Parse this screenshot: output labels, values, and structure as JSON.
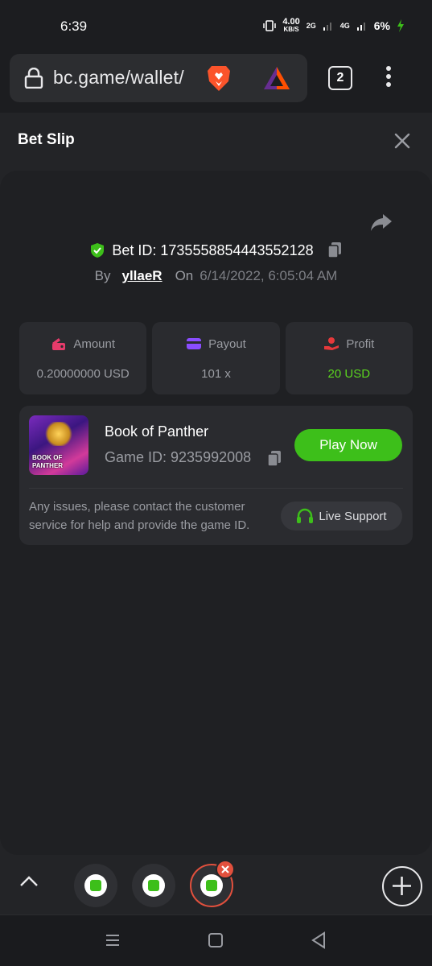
{
  "status": {
    "time": "6:39",
    "speed_value": "4.00",
    "speed_unit": "KB/S",
    "net_2g": "2G",
    "net_4g": "4G",
    "battery": "6%"
  },
  "browser": {
    "url": "bc.game/wallet/",
    "tab_count": "2",
    "icons": [
      "lock-icon",
      "brave-lion-icon",
      "brave-rewards-icon",
      "more-vert-icon"
    ]
  },
  "slip": {
    "title": "Bet Slip",
    "bet_id_label": "Bet ID: 1735558854443552128",
    "by_label": "By",
    "user": "yllaeR",
    "on_label": "On",
    "date": "6/14/2022, 6:05:04 AM"
  },
  "stats": [
    {
      "label": "Amount",
      "value": "0.20000000 USD",
      "icon": "amount-icon",
      "color": "#e63b6b"
    },
    {
      "label": "Payout",
      "value": "101 x",
      "icon": "payout-card-icon",
      "color": "#8a4dff"
    },
    {
      "label": "Profit",
      "value": "20 USD",
      "icon": "profit-hand-icon",
      "color": "#e6393b"
    }
  ],
  "game": {
    "name": "Book of Panther",
    "game_id_label": "Game ID: 9235992008",
    "play_label": "Play Now",
    "thumb_text": "BOOK OF PANTHER",
    "issues_text": "Any issues, please contact the customer service for help and provide the game ID.",
    "support_label": "Live Support"
  },
  "colors": {
    "accent_green": "#3dbf1a",
    "profit_green": "#5bd51f",
    "active_tab_red": "#e2503d"
  }
}
